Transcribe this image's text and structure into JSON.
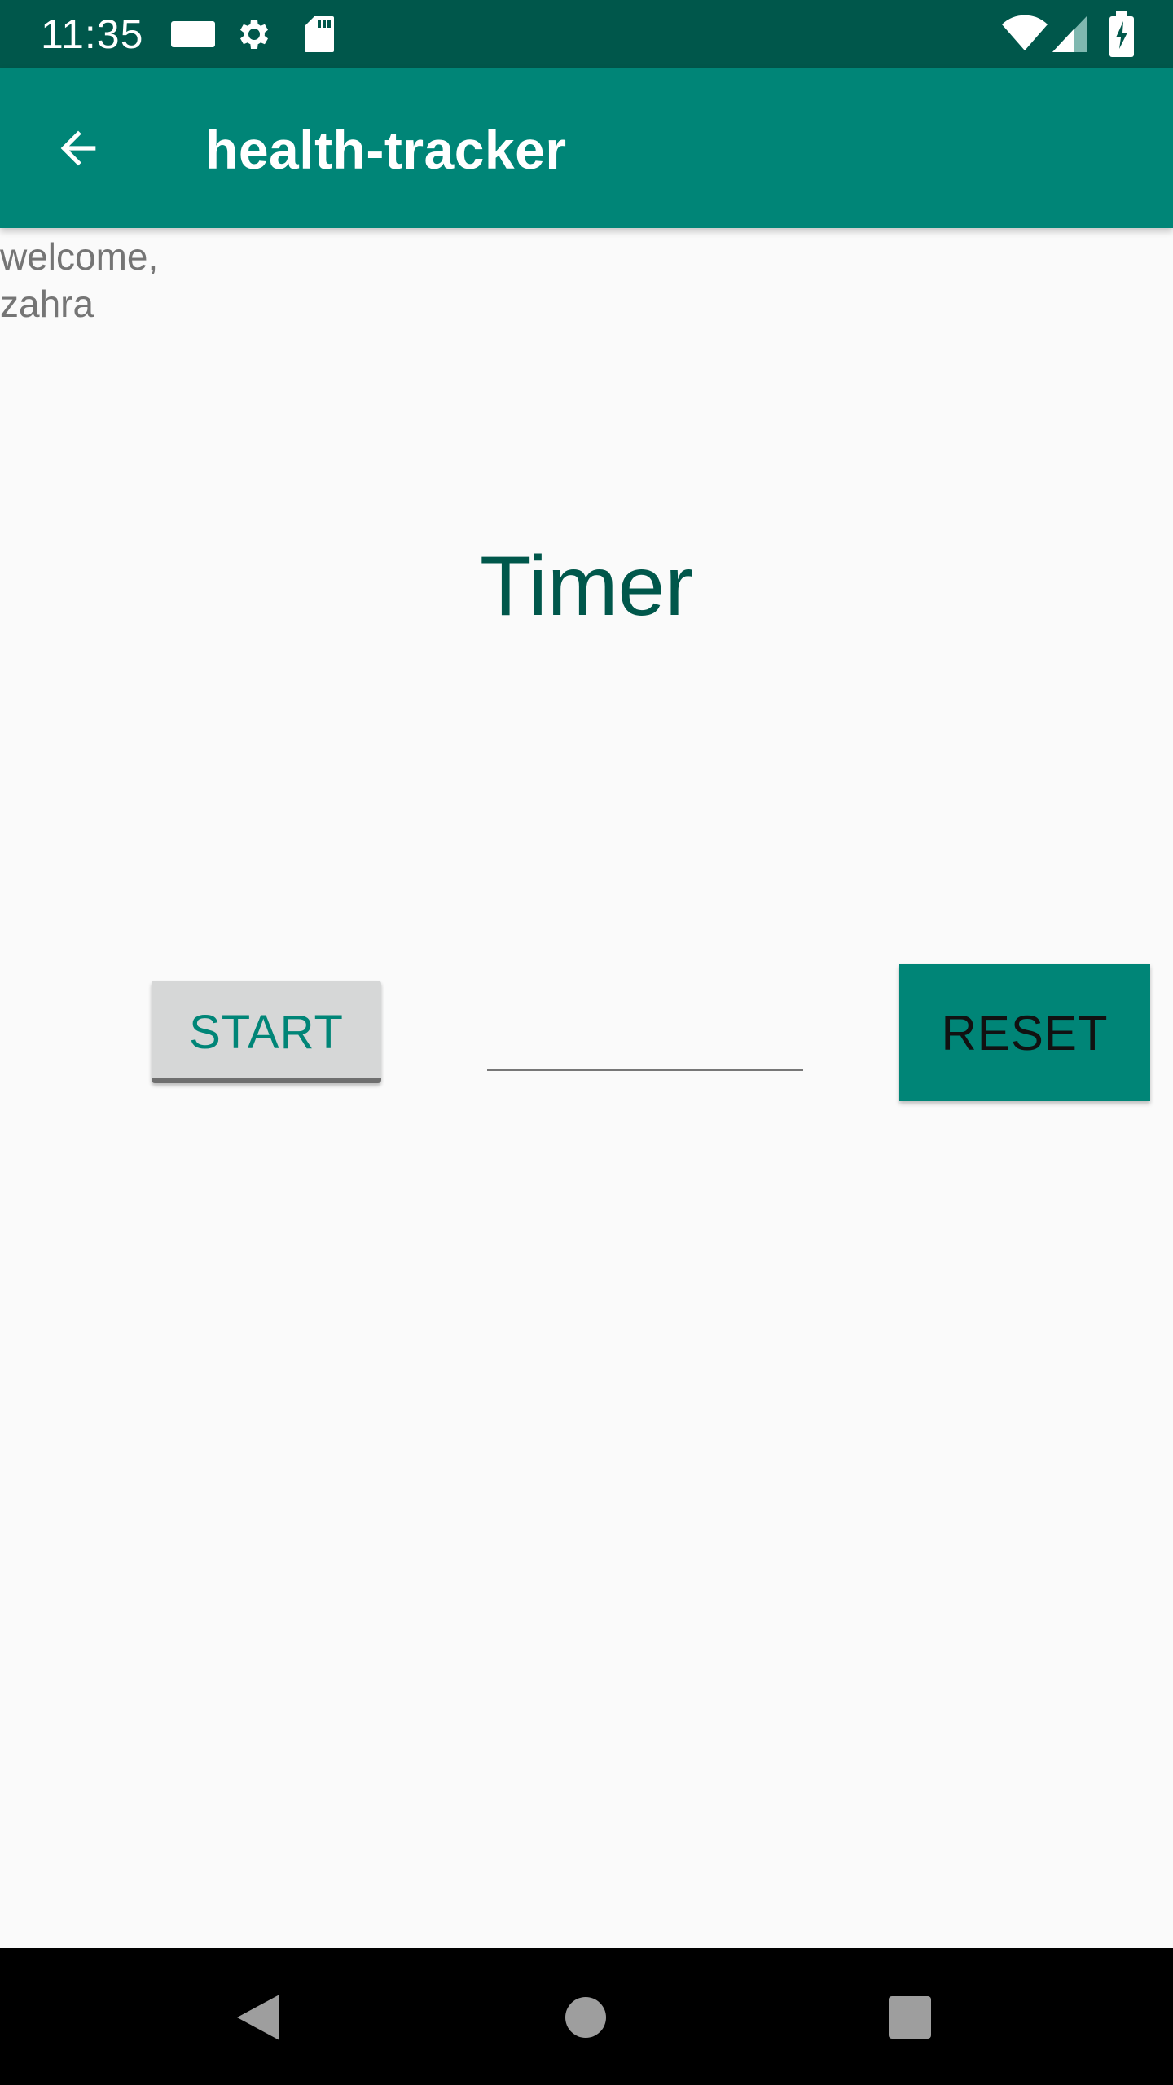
{
  "status_bar": {
    "time": "11:35",
    "icons": [
      "notification-icon",
      "gear-icon",
      "sd-card-icon",
      "wifi-icon",
      "signal-icon",
      "battery-charging-icon"
    ]
  },
  "app_bar": {
    "title": "health-tracker",
    "back_icon": "arrow-back-icon",
    "color": "#008577"
  },
  "content": {
    "welcome_text": "welcome, zahra",
    "heading": "Timer",
    "start_label": "START",
    "input_value": "",
    "reset_label": "RESET"
  },
  "nav_bar": {
    "icons": [
      "nav-back-icon",
      "nav-home-icon",
      "nav-recents-icon"
    ]
  },
  "colors": {
    "primary": "#008577",
    "primary_dark": "#00574b",
    "background": "#fafafa"
  }
}
